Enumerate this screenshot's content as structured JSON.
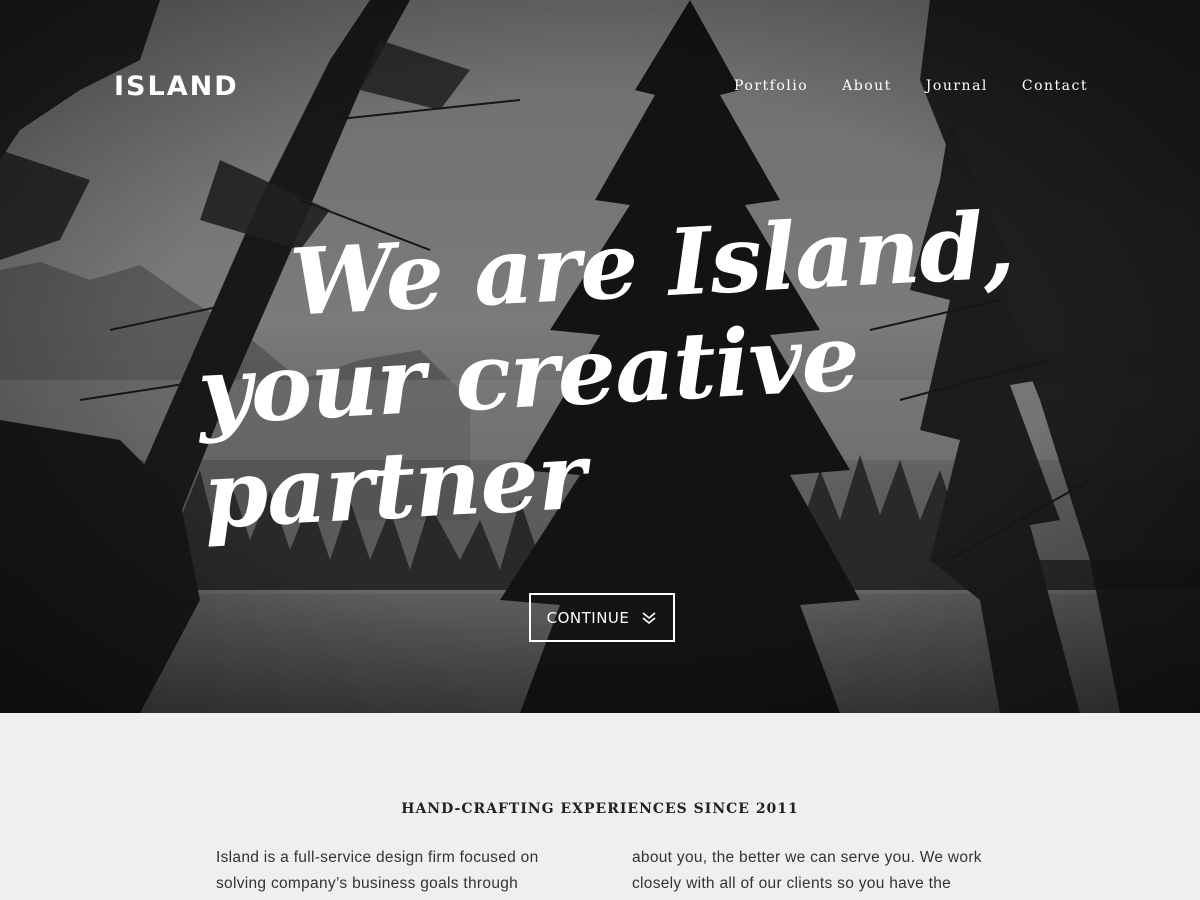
{
  "header": {
    "logo": "ISLAND",
    "nav": [
      "Portfolio",
      "About",
      "Journal",
      "Contact"
    ]
  },
  "hero": {
    "headline_line1": "We are Island,",
    "headline_line2": "your creative partner",
    "continue_label": "CONTINUE"
  },
  "intro": {
    "tagline": "HAND-CRAFTING EXPERIENCES SINCE 2011",
    "left_text": "Island is a full-service design firm focused on solving company’s business goals through",
    "right_text": "about you, the better we can serve you. We work closely with all of our clients so you have the"
  }
}
